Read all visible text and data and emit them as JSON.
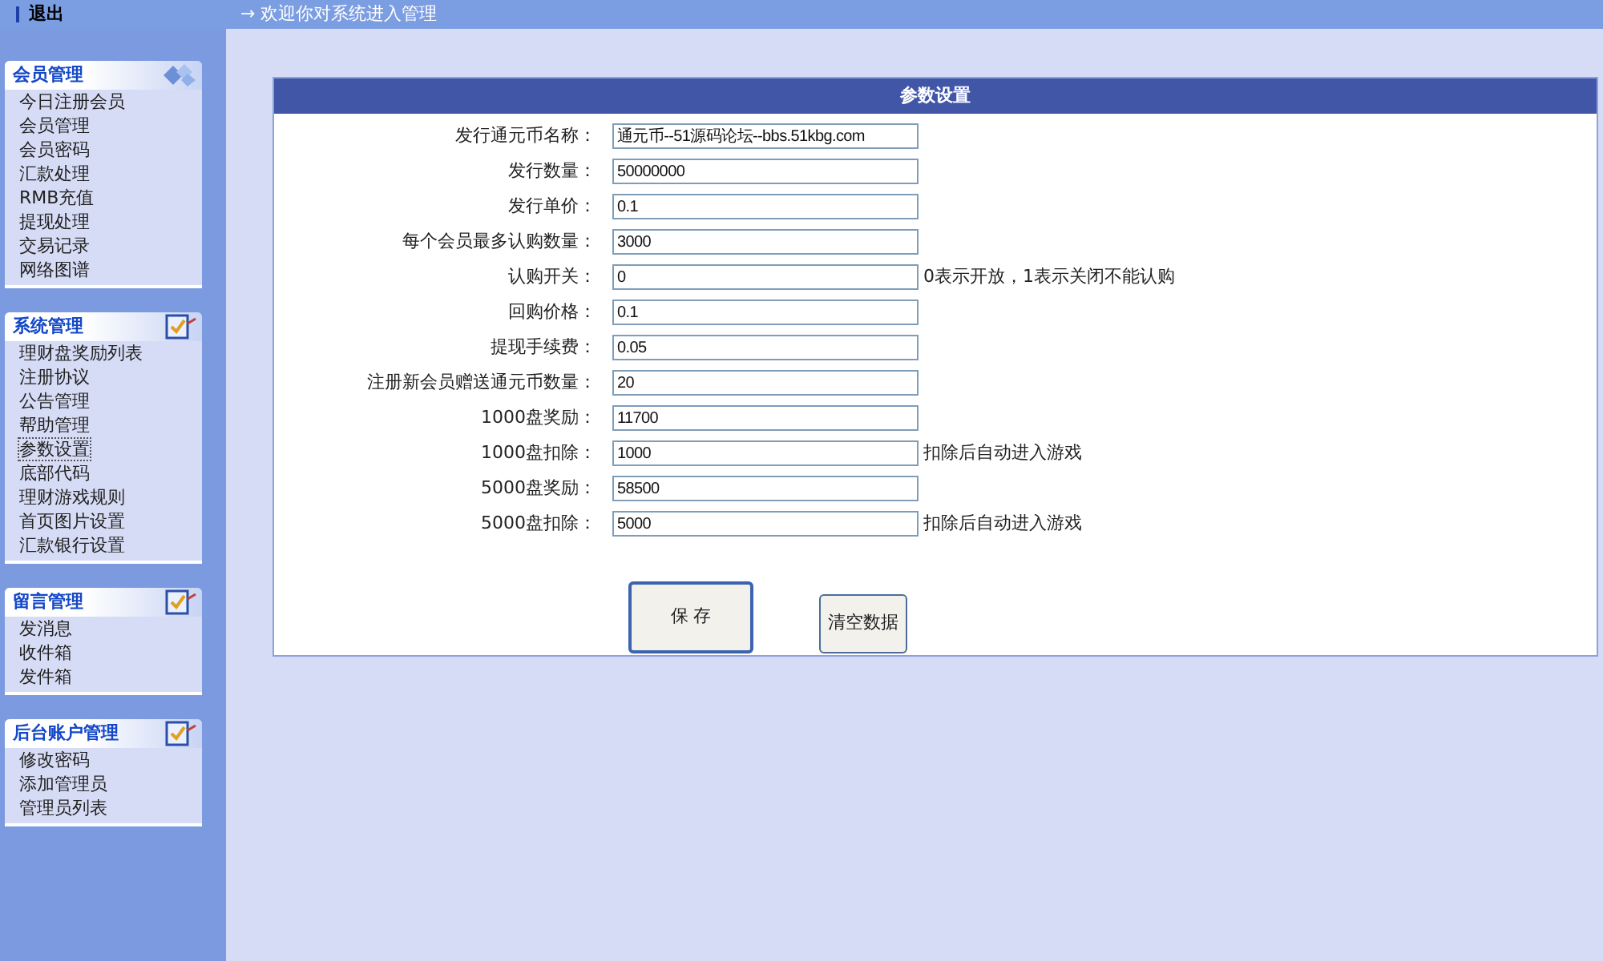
{
  "top_bar": {
    "logout": "退出",
    "welcome": "→ 欢迎你对系统进入管理"
  },
  "sidebar": {
    "groups": [
      {
        "title": "会员管理",
        "kind": "gems",
        "items": [
          {
            "label": "今日注册会员",
            "selected": false
          },
          {
            "label": "会员管理",
            "selected": false
          },
          {
            "label": "会员密码",
            "selected": false
          },
          {
            "label": "汇款处理",
            "selected": false
          },
          {
            "label": "RMB充值",
            "selected": false
          },
          {
            "label": "提现处理",
            "selected": false
          },
          {
            "label": "交易记录",
            "selected": false
          },
          {
            "label": "网络图谱",
            "selected": false
          }
        ]
      },
      {
        "title": "系统管理",
        "kind": "checklist",
        "items": [
          {
            "label": "理财盘奖励列表",
            "selected": false
          },
          {
            "label": "注册协议",
            "selected": false
          },
          {
            "label": "公告管理",
            "selected": false
          },
          {
            "label": "帮助管理",
            "selected": false
          },
          {
            "label": "参数设置",
            "selected": true
          },
          {
            "label": "底部代码",
            "selected": false
          },
          {
            "label": "理财游戏规则",
            "selected": false
          },
          {
            "label": "首页图片设置",
            "selected": false
          },
          {
            "label": "汇款银行设置",
            "selected": false
          }
        ]
      },
      {
        "title": "留言管理",
        "kind": "checklist",
        "items": [
          {
            "label": "发消息",
            "selected": false
          },
          {
            "label": "收件箱",
            "selected": false
          },
          {
            "label": "发件箱",
            "selected": false
          }
        ]
      },
      {
        "title": "后台账户管理",
        "kind": "checklist",
        "items": [
          {
            "label": "修改密码",
            "selected": false
          },
          {
            "label": "添加管理员",
            "selected": false
          },
          {
            "label": "管理员列表",
            "selected": false
          }
        ]
      }
    ]
  },
  "panel": {
    "title": "参数设置",
    "fields": [
      {
        "label": "发行通元币名称：",
        "value": "通元币--51源码论坛--bbs.51kbg.com"
      },
      {
        "label": "发行数量：",
        "value": "50000000"
      },
      {
        "label": "发行单价：",
        "value": "0.1"
      },
      {
        "label": "每个会员最多认购数量：",
        "value": "3000"
      },
      {
        "label": "认购开关：",
        "value": "0",
        "note": "0表示开放，1表示关闭不能认购"
      },
      {
        "label": "回购价格：",
        "value": "0.1"
      },
      {
        "label": "提现手续费：",
        "value": "0.05"
      },
      {
        "label": "注册新会员赠送通元币数量：",
        "value": "20"
      },
      {
        "label": "1000盘奖励：",
        "value": "11700"
      },
      {
        "label": "1000盘扣除：",
        "value": "1000",
        "note": "扣除后自动进入游戏"
      },
      {
        "label": "5000盘奖励：",
        "value": "58500"
      },
      {
        "label": "5000盘扣除：",
        "value": "5000",
        "note": "扣除后自动进入游戏"
      }
    ],
    "buttons": [
      "保 存",
      "清空数据"
    ]
  }
}
